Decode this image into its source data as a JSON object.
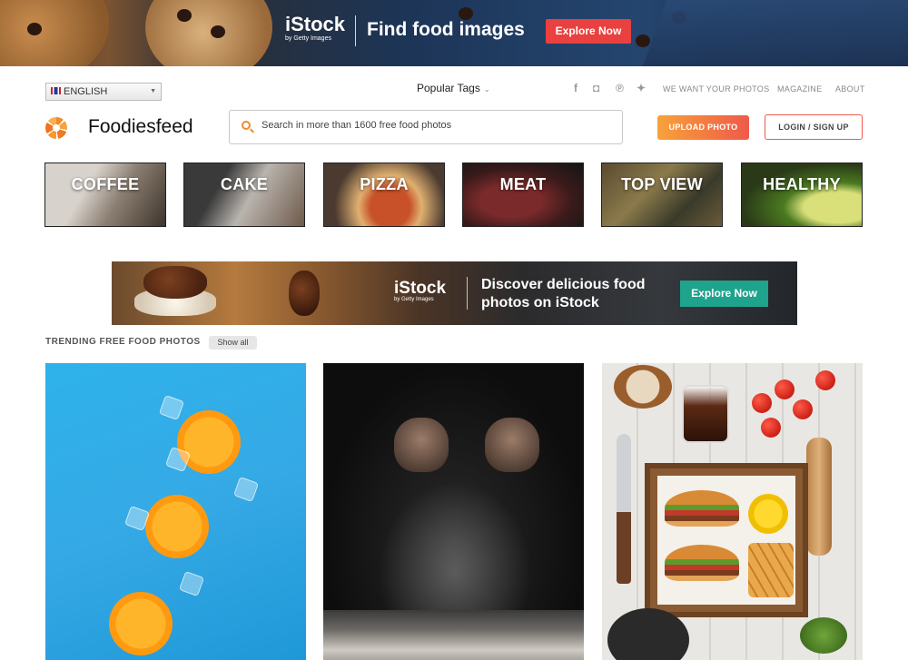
{
  "top_banner": {
    "logo": "iStock",
    "logo_sub": "by Getty Images",
    "headline": "Find food images",
    "cta": "Explore Now"
  },
  "header": {
    "language": "ENGLISH",
    "popular_tags": "Popular Tags",
    "social_icons": [
      "facebook-icon",
      "instagram-icon",
      "pinterest-icon",
      "twitter-icon"
    ],
    "social_glyphs": [
      "f",
      "◘",
      "℗",
      "✦"
    ],
    "links": [
      "WE WANT YOUR PHOTOS",
      "MAGAZINE",
      "ABOUT"
    ],
    "site_name": "Foodiesfeed",
    "search_placeholder": "Search in more than 1600 free food photos",
    "upload_label": "UPLOAD PHOTO",
    "login_label": "LOGIN / SIGN UP"
  },
  "categories": [
    "COFFEE",
    "CAKE",
    "PIZZA",
    "MEAT",
    "TOP VIEW",
    "HEALTHY"
  ],
  "mid_banner": {
    "logo": "iStock",
    "logo_sub": "by Getty Images",
    "line1": "Discover delicious food",
    "line2": "photos on iStock",
    "cta": "Explore Now"
  },
  "trending": {
    "title": "TRENDING FREE FOOD PHOTOS",
    "show_all": "Show all"
  },
  "colors": {
    "brand_orange": "#f08a2a",
    "upload_gradient_start": "#f7a23a",
    "upload_gradient_end": "#ef5a4a",
    "banner_cta": "#e8413f",
    "mid_cta": "#1ea38c"
  }
}
